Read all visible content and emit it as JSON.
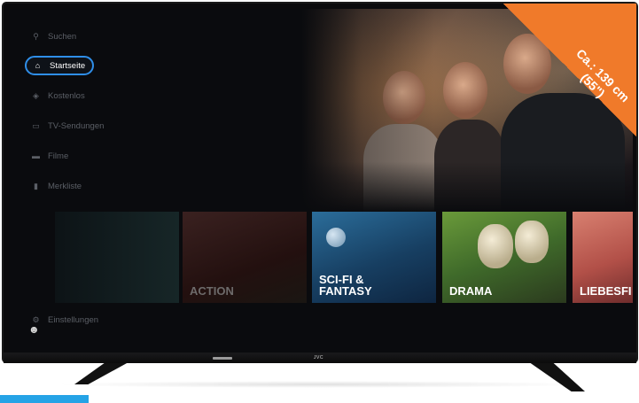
{
  "sidebar": {
    "items": [
      {
        "label": "Suchen",
        "icon": "search-icon"
      },
      {
        "label": "Startseite",
        "icon": "home-icon",
        "active": true
      },
      {
        "label": "Kostenlos",
        "icon": "tag-icon"
      },
      {
        "label": "TV-Sendungen",
        "icon": "tv-icon"
      },
      {
        "label": "Filme",
        "icon": "film-icon"
      },
      {
        "label": "Merkliste",
        "icon": "bookmark-icon"
      }
    ],
    "settings_label": "Einstellungen",
    "profile_icon": "robot-avatar-icon"
  },
  "genres": [
    {
      "label": ""
    },
    {
      "label": "ACTION"
    },
    {
      "label": "SCI-FI &\nFANTASY"
    },
    {
      "label": "DRAMA"
    },
    {
      "label": "LIEBESFI"
    }
  ],
  "badge": {
    "text": "Ca.: 139 cm\n(55\")",
    "color": "#f07a2a"
  },
  "tv": {
    "brand": "JVC"
  },
  "colors": {
    "accent": "#2f8ee8",
    "background": "#0a0b0e"
  }
}
